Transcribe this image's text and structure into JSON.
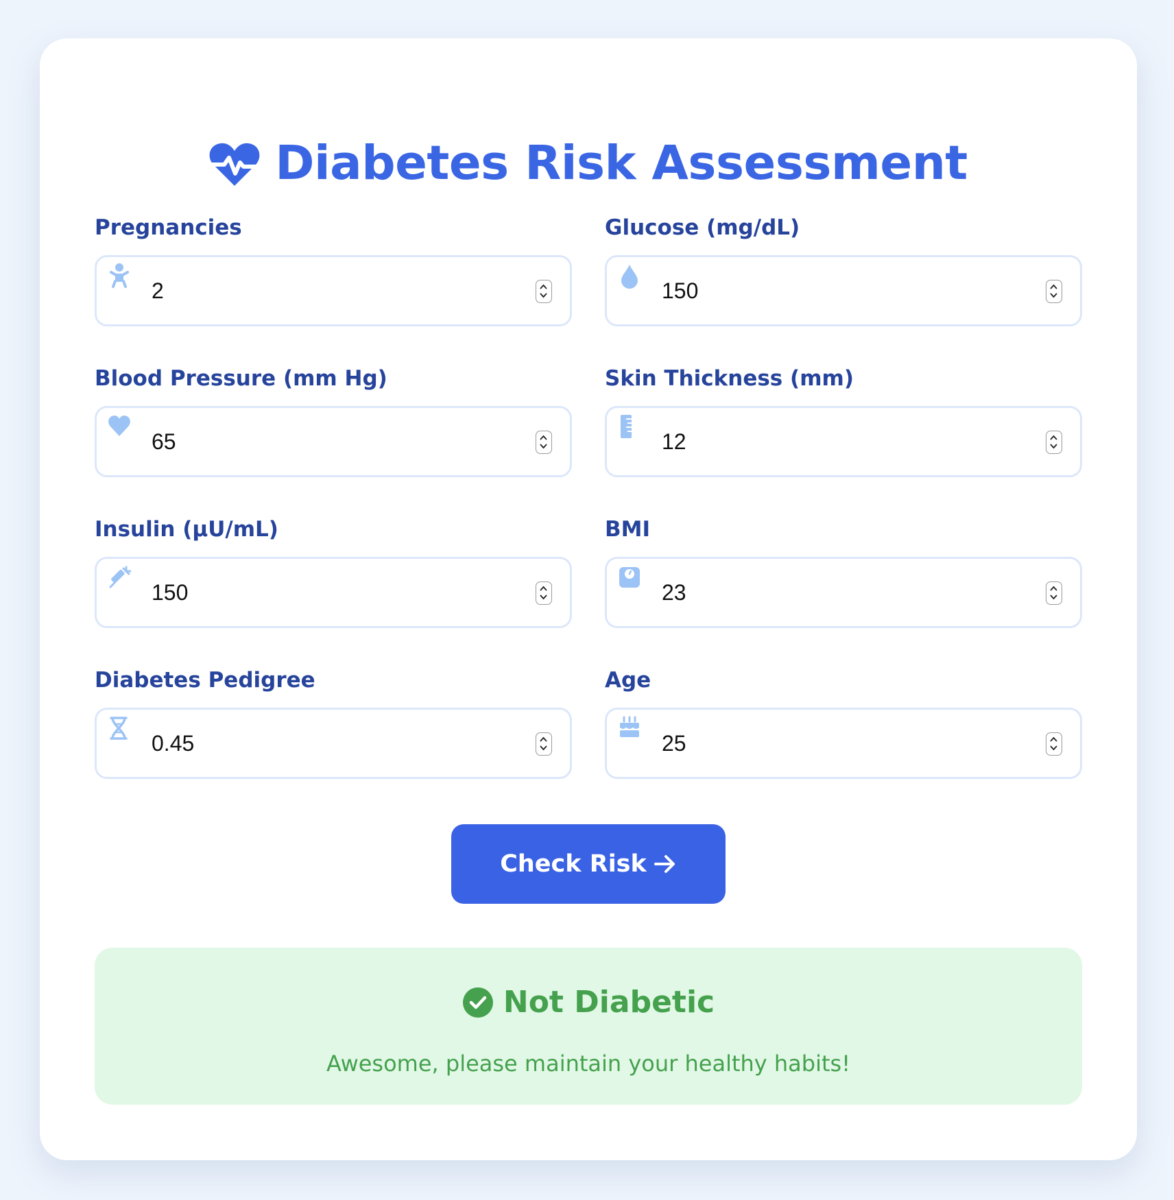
{
  "header": {
    "title": "Diabetes Risk Assessment",
    "icon": "heartbeat-icon",
    "accent_color": "#3a66e4"
  },
  "form": {
    "fields": [
      {
        "label": "Pregnancies",
        "value": "2",
        "icon": "baby-icon"
      },
      {
        "label": "Glucose (mg/dL)",
        "value": "150",
        "icon": "droplet-icon"
      },
      {
        "label": "Blood Pressure (mm Hg)",
        "value": "65",
        "icon": "heart-icon"
      },
      {
        "label": "Skin Thickness (mm)",
        "value": "12",
        "icon": "ruler-icon"
      },
      {
        "label": "Insulin (µU/mL)",
        "value": "150",
        "icon": "syringe-icon"
      },
      {
        "label": "BMI",
        "value": "23",
        "icon": "weight-scale-icon"
      },
      {
        "label": "Diabetes Pedigree",
        "value": "0.45",
        "icon": "dna-icon"
      },
      {
        "label": "Age",
        "value": "25",
        "icon": "birthday-cake-icon"
      }
    ],
    "label_color": "#27449c",
    "icon_color": "#9cc3f5"
  },
  "button": {
    "label": "Check Risk",
    "icon": "arrow-right-icon",
    "color": "#3a62e4"
  },
  "result": {
    "title": "Not Diabetic",
    "message": "Awesome, please maintain your healthy habits!",
    "icon": "check-circle-icon",
    "text_color": "#45a14d",
    "background": "#e1f8e6"
  }
}
